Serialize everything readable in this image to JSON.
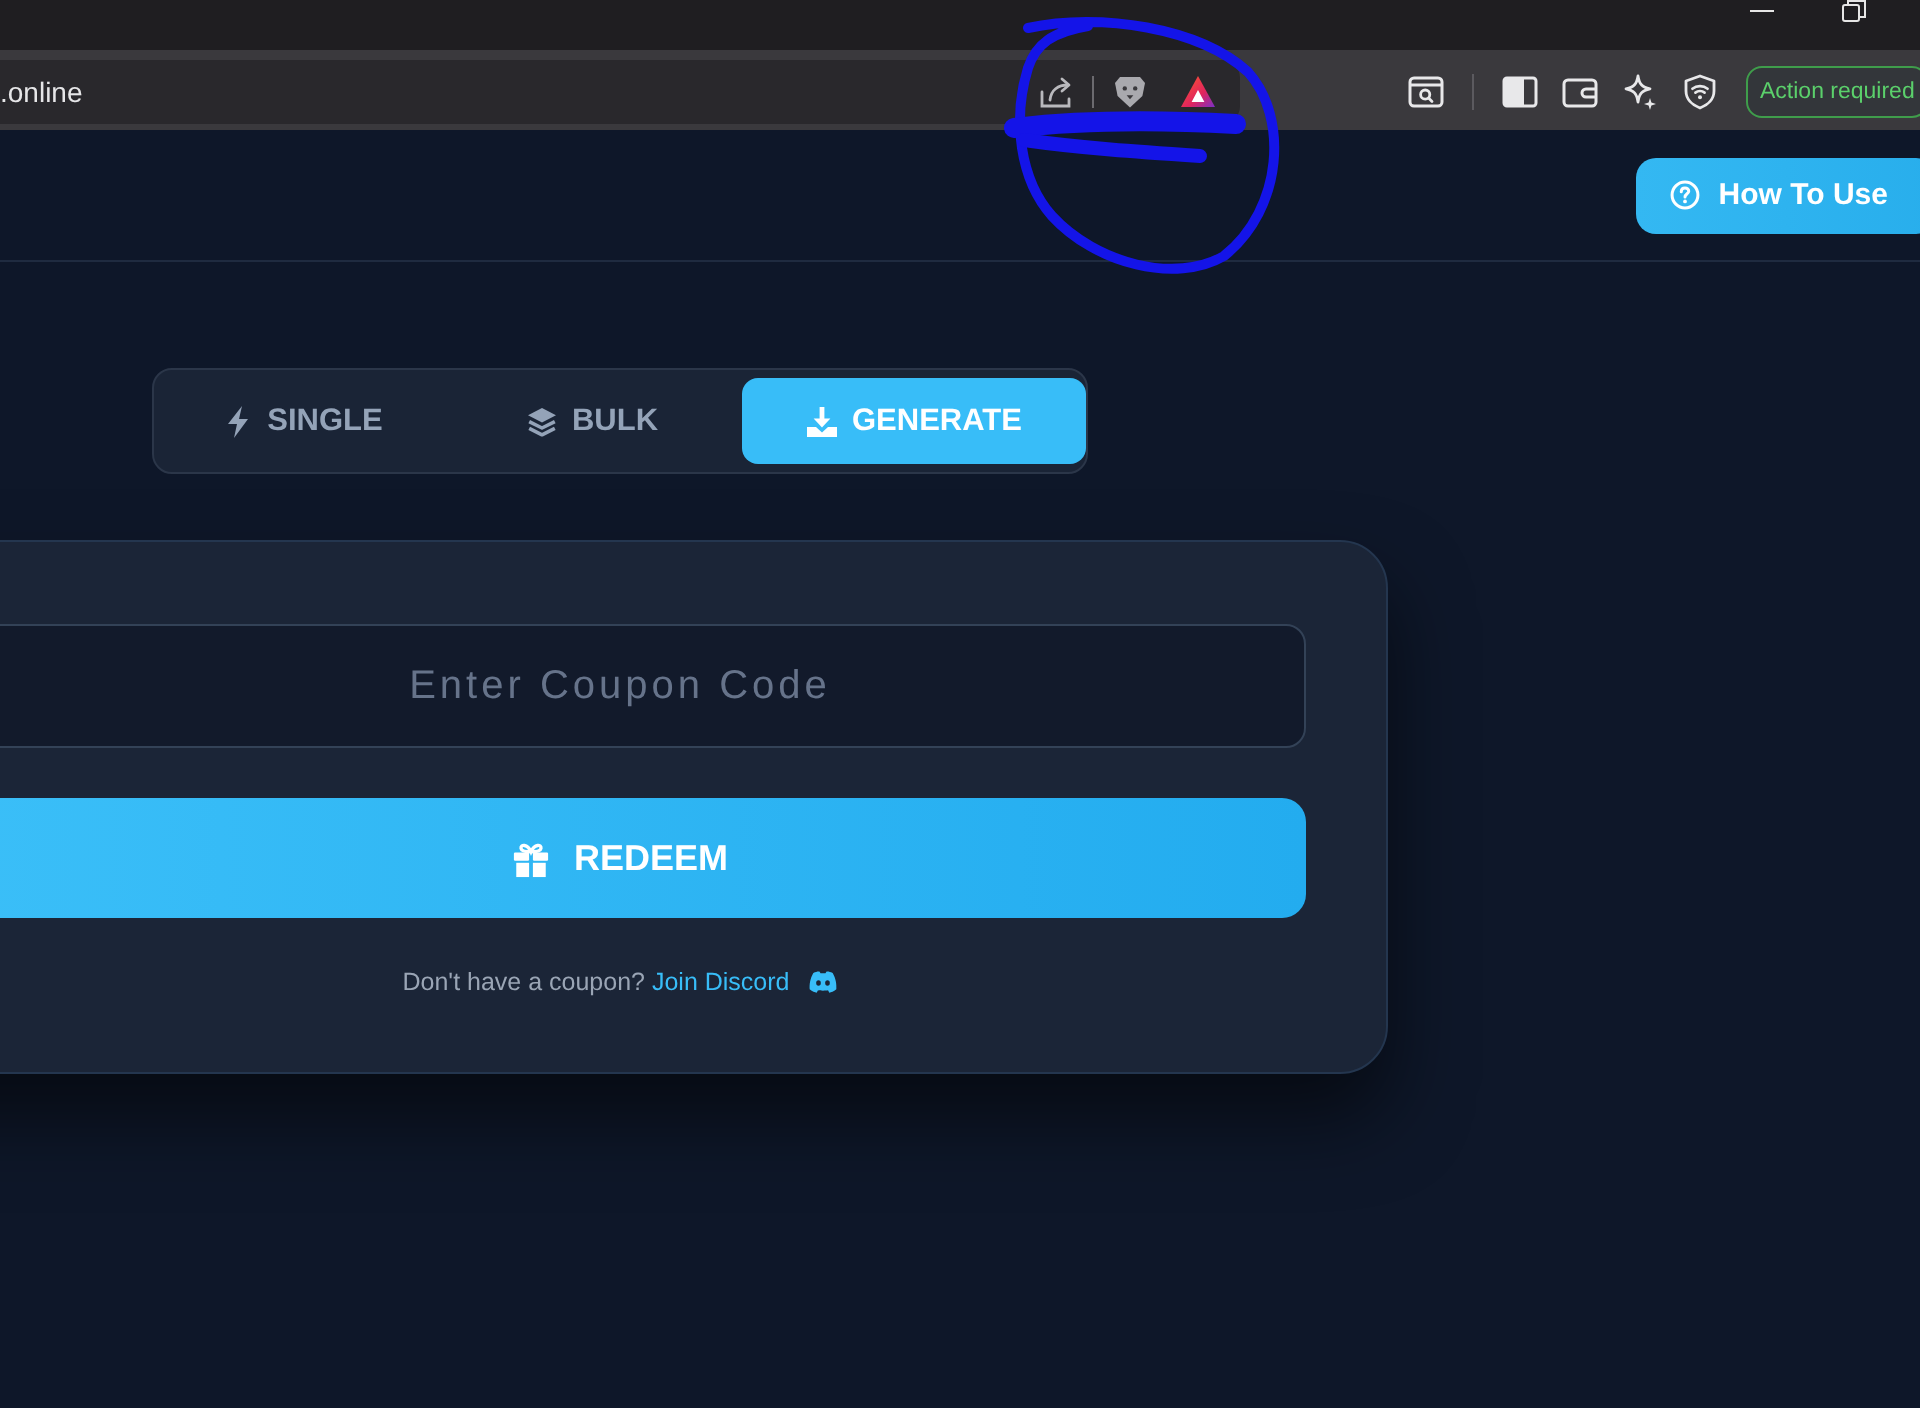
{
  "browser": {
    "url": ".online",
    "status_badge": "Action required"
  },
  "header": {
    "help_button": "How To Use"
  },
  "mode_tabs": [
    {
      "kind": "single",
      "label": "SINGLE",
      "selected": false
    },
    {
      "kind": "bulk",
      "label": "BULK",
      "selected": false
    },
    {
      "kind": "generate",
      "label": "GENERATE",
      "selected": true
    }
  ],
  "redeem_card": {
    "coupon_field": {
      "placeholder": "Enter Coupon Code"
    },
    "redeem_button": "REDEEM",
    "prompt": "Don't have a coupon?",
    "link": "Join Discord"
  }
}
